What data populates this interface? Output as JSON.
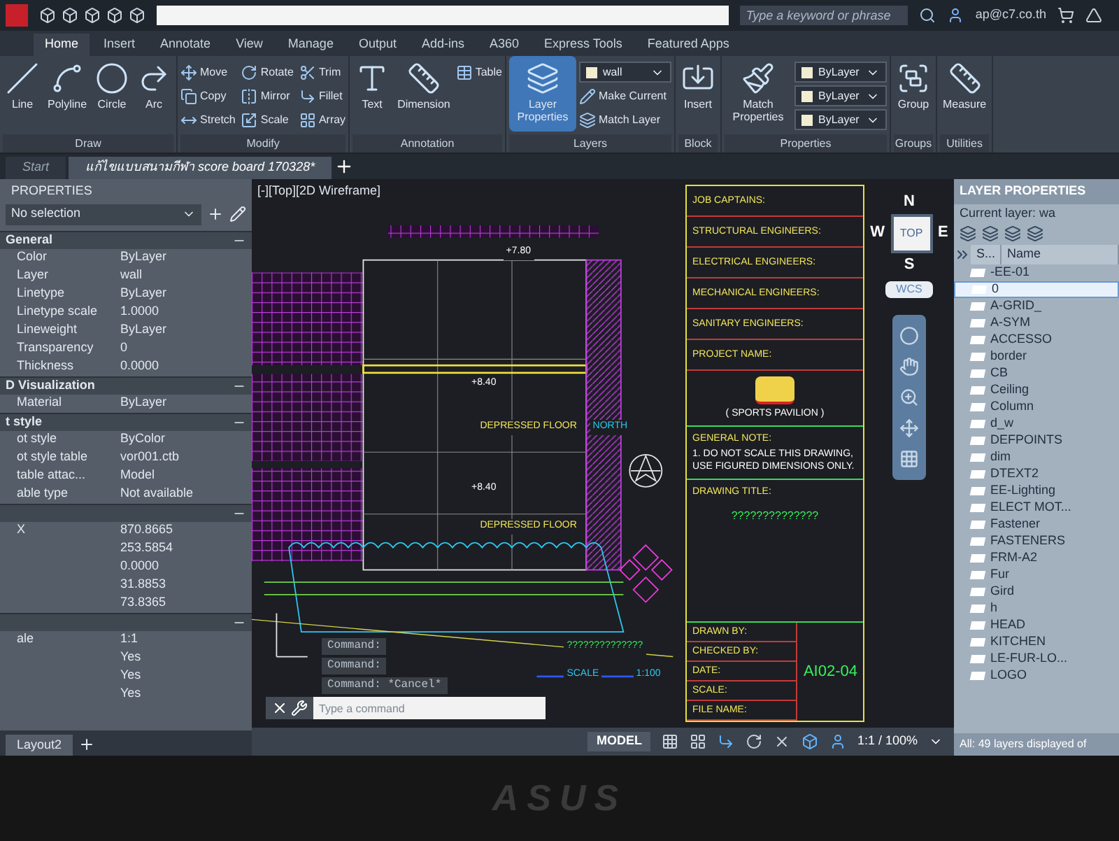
{
  "title_bar": {
    "search": {
      "placeholder": "Type a keyword or phrase"
    },
    "user": "ap@c7.co.th"
  },
  "ribbon_tabs": [
    {
      "label": "Home",
      "selected": true
    },
    {
      "label": "Insert",
      "selected": false
    },
    {
      "label": "Annotate",
      "selected": false
    },
    {
      "label": "View",
      "selected": false
    },
    {
      "label": "Manage",
      "selected": false
    },
    {
      "label": "Output",
      "selected": false
    },
    {
      "label": "Add-ins",
      "selected": false
    },
    {
      "label": "A360",
      "selected": false
    },
    {
      "label": "Express Tools",
      "selected": false
    },
    {
      "label": "Featured Apps",
      "selected": false
    }
  ],
  "ribbon_panels": [
    {
      "title": "Draw",
      "tools": [
        {
          "label": "Line",
          "kind": "large"
        },
        {
          "label": "Polyline",
          "kind": "large"
        },
        {
          "label": "Circle",
          "kind": "large"
        },
        {
          "label": "Arc",
          "kind": "large"
        }
      ]
    },
    {
      "title": "Modify",
      "tools": [
        {
          "label": "Move",
          "kind": "small"
        },
        {
          "label": "Copy",
          "kind": "small"
        },
        {
          "label": "Stretch",
          "kind": "small"
        },
        {
          "label": "Rotate",
          "kind": "small"
        },
        {
          "label": "Mirror",
          "kind": "small"
        },
        {
          "label": "Scale",
          "kind": "small"
        },
        {
          "label": "Trim",
          "kind": "small"
        },
        {
          "label": "Fillet",
          "kind": "small"
        },
        {
          "label": "Array",
          "kind": "small"
        }
      ]
    },
    {
      "title": "Annotation",
      "tools": [
        {
          "label": "Text",
          "kind": "large"
        },
        {
          "label": "Dimension",
          "kind": "large"
        },
        {
          "label": "Table",
          "kind": "small"
        }
      ]
    },
    {
      "title": "Layers",
      "tools": [
        {
          "label": "Layer Properties",
          "kind": "large",
          "selected": true
        },
        {
          "label": "wall",
          "kind": "dropdown"
        },
        {
          "label": "Make Current",
          "kind": "small"
        },
        {
          "label": "Match Layer",
          "kind": "small"
        }
      ]
    },
    {
      "title": "Block",
      "tools": [
        {
          "label": "Insert",
          "kind": "large"
        }
      ]
    },
    {
      "title": "Properties",
      "tools": [
        {
          "label": "Match Properties",
          "kind": "large"
        },
        {
          "label": "ByLayer",
          "kind": "dropdown"
        },
        {
          "label": "ByLayer",
          "kind": "dropdown"
        },
        {
          "label": "ByLayer",
          "kind": "dropdown"
        }
      ]
    },
    {
      "title": "Groups",
      "tools": [
        {
          "label": "Group",
          "kind": "large"
        }
      ]
    },
    {
      "title": "Utilities",
      "tools": [
        {
          "label": "Measure",
          "kind": "large"
        }
      ]
    }
  ],
  "file_tabs": [
    {
      "label": "Start",
      "selected": false
    },
    {
      "label": "แก้ไขแบบสนามกีฬา score board 170328*",
      "selected": true
    }
  ],
  "properties_palette": {
    "title": "PROPERTIES",
    "selection": "No selection",
    "sections": [
      {
        "title": "General",
        "expanded": true,
        "rows": [
          {
            "label": "Color",
            "value": "ByLayer"
          },
          {
            "label": "Layer",
            "value": "wall"
          },
          {
            "label": "Linetype",
            "value": "ByLayer"
          },
          {
            "label": "Linetype scale",
            "value": "1.0000"
          },
          {
            "label": "Lineweight",
            "value": "ByLayer"
          },
          {
            "label": "Transparency",
            "value": "0"
          },
          {
            "label": "Thickness",
            "value": "0.0000"
          }
        ]
      },
      {
        "title": "D Visualization",
        "expanded": true,
        "rows": [
          {
            "label": "Material",
            "value": "ByLayer"
          }
        ]
      },
      {
        "title": "t style",
        "expanded": true,
        "rows": [
          {
            "label": "ot style",
            "value": "ByColor"
          },
          {
            "label": "ot style table",
            "value": "vor001.ctb"
          },
          {
            "label": "table attac...",
            "value": "Model"
          },
          {
            "label": "able type",
            "value": "Not available"
          }
        ]
      },
      {
        "expanded": true,
        "rows": [
          {
            "label": "X",
            "value": "870.8665"
          },
          {
            "value": "253.5854"
          },
          {
            "value": "0.0000"
          },
          {
            "value": "31.8853"
          },
          {
            "value": "73.8365"
          }
        ]
      },
      {
        "expanded": true,
        "rows": [
          {
            "label": "ale",
            "value": "1:1"
          },
          {
            "value": "Yes"
          },
          {
            "value": "Yes"
          },
          {
            "value": "Yes"
          }
        ]
      }
    ]
  },
  "layout_tabs": [
    {
      "label": "Layout2",
      "selected": true
    }
  ],
  "viewport": {
    "label": "[-][Top][2D Wireframe]",
    "plan_labels": [
      "+7.80",
      "+8.40",
      "DEPRESSED FLOOR",
      "+8.40",
      "DEPRESSED FLOOR",
      "NORTH",
      "??????????????",
      "SCALE",
      "1:100"
    ],
    "viewcube": {
      "north": "N",
      "east": "E",
      "south": "S",
      "west": "W",
      "face": "TOP",
      "ucs": "WCS"
    }
  },
  "title_block": {
    "headings": [
      "JOB CAPTAINS:",
      "STRUCTURAL ENGINEERS:",
      "ELECTRICAL ENGINEERS:",
      "MECHANICAL ENGINEERS:",
      "SANITARY ENGINEERS:",
      "PROJECT NAME:"
    ],
    "project_subtitle": "( SPORTS PAVILION )",
    "note_heading": "GENERAL NOTE:",
    "note": "1. DO NOT SCALE THIS DRAWING, USE FIGURED DIMENSIONS ONLY.",
    "drawing_title_heading": "DRAWING TITLE:",
    "drawing_title": "??????????????",
    "fields": [
      "DRAWN BY:",
      "CHECKED BY:",
      "DATE:",
      "SCALE:",
      "FILE NAME:"
    ],
    "sheet_number": "AI02-04"
  },
  "command_line": {
    "history": [
      "Command:",
      "Command:",
      "Command: *Cancel*"
    ],
    "placeholder": "Type a command"
  },
  "status_bar": {
    "model": "MODEL",
    "scale": "1:1 / 100%"
  },
  "layer_palette": {
    "title": "LAYER PROPERTIES",
    "current_layer": "Current layer: wa",
    "columns": [
      "S...",
      "Name"
    ],
    "layers": [
      {
        "name": "-EE-01",
        "selected": false
      },
      {
        "name": "0",
        "selected": true
      },
      {
        "name": "A-GRID_",
        "selected": false
      },
      {
        "name": "A-SYM",
        "selected": false
      },
      {
        "name": "ACCESSO",
        "selected": false
      },
      {
        "name": "border",
        "selected": false
      },
      {
        "name": "CB",
        "selected": false
      },
      {
        "name": "Ceiling",
        "selected": false
      },
      {
        "name": "Column",
        "selected": false
      },
      {
        "name": "d_w",
        "selected": false
      },
      {
        "name": "DEFPOINTS",
        "selected": false
      },
      {
        "name": "dim",
        "selected": false
      },
      {
        "name": "DTEXT2",
        "selected": false
      },
      {
        "name": "EE-Lighting",
        "selected": false
      },
      {
        "name": "ELECT MOT...",
        "selected": false
      },
      {
        "name": "Fastener",
        "selected": false
      },
      {
        "name": "FASTENERS",
        "selected": false
      },
      {
        "name": "FRM-A2",
        "selected": false
      },
      {
        "name": "Fur",
        "selected": false
      },
      {
        "name": "Gird",
        "selected": false
      },
      {
        "name": "h",
        "selected": false
      },
      {
        "name": "HEAD",
        "selected": false
      },
      {
        "name": "KITCHEN",
        "selected": false
      },
      {
        "name": "LE-FUR-LO...",
        "selected": false
      },
      {
        "name": "LOGO",
        "selected": false
      }
    ],
    "footer": "All: 49 layers displayed of"
  },
  "bezel": {
    "logo": "ASUS"
  }
}
